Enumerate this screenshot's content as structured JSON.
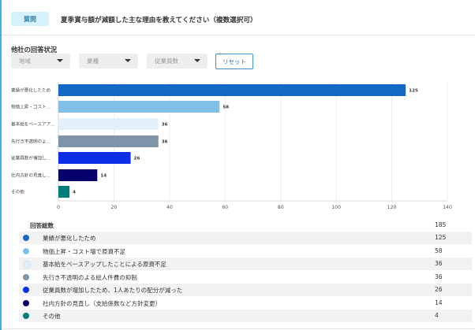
{
  "question": {
    "badge": "質問",
    "text": "夏季賞与額が減額した主な理由を教えてください（複数選択可）"
  },
  "section_title": "他社の回答状況",
  "filters": [
    {
      "placeholder": "地域"
    },
    {
      "placeholder": "業種"
    },
    {
      "placeholder": "従業員数"
    }
  ],
  "reset_label": "リセット",
  "chart_data": {
    "type": "bar",
    "orientation": "horizontal",
    "categories": [
      "業績が悪化したため",
      "物価上昇・コスト...",
      "基本給をベースアア...",
      "先行き不透明のよ...",
      "従業員数が増加し...",
      "社内方針の見直し...",
      "その他"
    ],
    "values": [
      125,
      58,
      36,
      36,
      26,
      14,
      4
    ],
    "colors": [
      "#1369c4",
      "#82bfe8",
      "#e2f0fc",
      "#7f94a8",
      "#0c2ee6",
      "#07006b",
      "#007d7d"
    ],
    "xlim": [
      0,
      140
    ],
    "xticks": [
      0,
      20,
      40,
      60,
      80,
      100,
      120,
      140
    ],
    "grid": true
  },
  "summary": {
    "total_label": "回答総数",
    "total_value": "185",
    "rows": [
      {
        "label": "業績が悪化したため",
        "value": "125",
        "color": "#1369c4"
      },
      {
        "label": "物価上昇・コスト増で原資不足",
        "value": "58",
        "color": "#82bfe8"
      },
      {
        "label": "基本給をベースアップしたことによる原資不足",
        "value": "36",
        "color": "#e2f0fc"
      },
      {
        "label": "先行き不透明のよる総人件費の抑制",
        "value": "36",
        "color": "#7f94a8"
      },
      {
        "label": "従業員数が増加したため、1人あたりの配分が減った",
        "value": "26",
        "color": "#0c2ee6"
      },
      {
        "label": "社内方針の見直し（支給係数など方針変更）",
        "value": "14",
        "color": "#07006b"
      },
      {
        "label": "その他",
        "value": "4",
        "color": "#007d7d"
      }
    ]
  }
}
